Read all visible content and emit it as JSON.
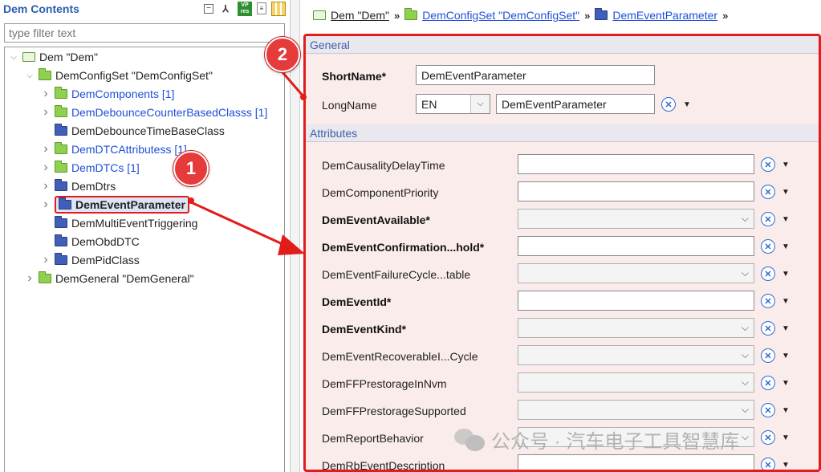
{
  "left_panel": {
    "title": "Dem Contents",
    "filter_placeholder": "type filter text",
    "tree": [
      {
        "label": "Dem \"Dem\"",
        "style": "plain",
        "folder": "hollow",
        "twisty": "v"
      },
      {
        "label": "DemConfigSet \"DemConfigSet\"",
        "style": "plain",
        "folder": "green",
        "twisty": "v"
      },
      {
        "label": "DemComponents [1]",
        "style": "link",
        "folder": "green",
        "twisty": ">"
      },
      {
        "label": "DemDebounceCounterBasedClasss [1]",
        "style": "link",
        "folder": "green",
        "twisty": ">"
      },
      {
        "label": "DemDebounceTimeBaseClass",
        "style": "plain",
        "folder": "blue",
        "twisty": ""
      },
      {
        "label": "DemDTCAttributess [1]",
        "style": "link",
        "folder": "green",
        "twisty": ">"
      },
      {
        "label": "DemDTCs [1]",
        "style": "link",
        "folder": "green",
        "twisty": ">"
      },
      {
        "label": "DemDtrs",
        "style": "plain",
        "folder": "blue",
        "twisty": ">"
      },
      {
        "label": "DemEventParameter",
        "style": "selected",
        "folder": "blue",
        "twisty": ">"
      },
      {
        "label": "DemMultiEventTriggering",
        "style": "plain",
        "folder": "blue",
        "twisty": ""
      },
      {
        "label": "DemObdDTC",
        "style": "plain",
        "folder": "blue",
        "twisty": ""
      },
      {
        "label": "DemPidClass",
        "style": "plain",
        "folder": "blue",
        "twisty": ">"
      },
      {
        "label": "DemGeneral \"DemGeneral\"",
        "style": "plain",
        "folder": "green",
        "twisty": ">"
      }
    ]
  },
  "breadcrumb": [
    {
      "label": "Dem \"Dem\"",
      "folder": "hollow",
      "style": "plain"
    },
    {
      "label": "DemConfigSet \"DemConfigSet\"",
      "folder": "green",
      "style": "link"
    },
    {
      "label": "DemEventParameter",
      "folder": "blue",
      "style": "link"
    }
  ],
  "general": {
    "section_title": "General",
    "short_name_label": "ShortName*",
    "short_name_value": "DemEventParameter",
    "long_name_label": "LongName",
    "language_value": "EN",
    "long_name_value": "DemEventParameter"
  },
  "attributes": {
    "section_title": "Attributes",
    "rows": [
      {
        "label": "DemCausalityDelayTime",
        "bold": false,
        "kind": "text"
      },
      {
        "label": "DemComponentPriority",
        "bold": false,
        "kind": "text"
      },
      {
        "label": "DemEventAvailable*",
        "bold": true,
        "kind": "combo"
      },
      {
        "label": "DemEventConfirmation...hold*",
        "bold": true,
        "kind": "text"
      },
      {
        "label": "DemEventFailureCycle...table",
        "bold": false,
        "kind": "combo"
      },
      {
        "label": "DemEventId*",
        "bold": true,
        "kind": "text"
      },
      {
        "label": "DemEventKind*",
        "bold": true,
        "kind": "combo"
      },
      {
        "label": "DemEventRecoverableI...Cycle",
        "bold": false,
        "kind": "combo"
      },
      {
        "label": "DemFFPrestorageInNvm",
        "bold": false,
        "kind": "combo"
      },
      {
        "label": "DemFFPrestorageSupported",
        "bold": false,
        "kind": "combo"
      },
      {
        "label": "DemReportBehavior",
        "bold": false,
        "kind": "combo"
      },
      {
        "label": "DemRbEventDescription",
        "bold": false,
        "kind": "text"
      }
    ]
  },
  "callouts": {
    "one": "1",
    "two": "2"
  },
  "watermark": "公众号 · 汽车电子工具智慧库",
  "icons": {
    "collapse": "collapse-all-icon",
    "link": "link-with-editor-icon",
    "vp": "vp-res-icon",
    "doc": "document-icon",
    "grid": "table-icon",
    "clear": "clear-value-icon",
    "menu": "dropdown-menu-icon"
  },
  "colors": {
    "highlight": "#e31b1b",
    "link": "#1f4fd8",
    "section_text": "#3f5faa"
  }
}
